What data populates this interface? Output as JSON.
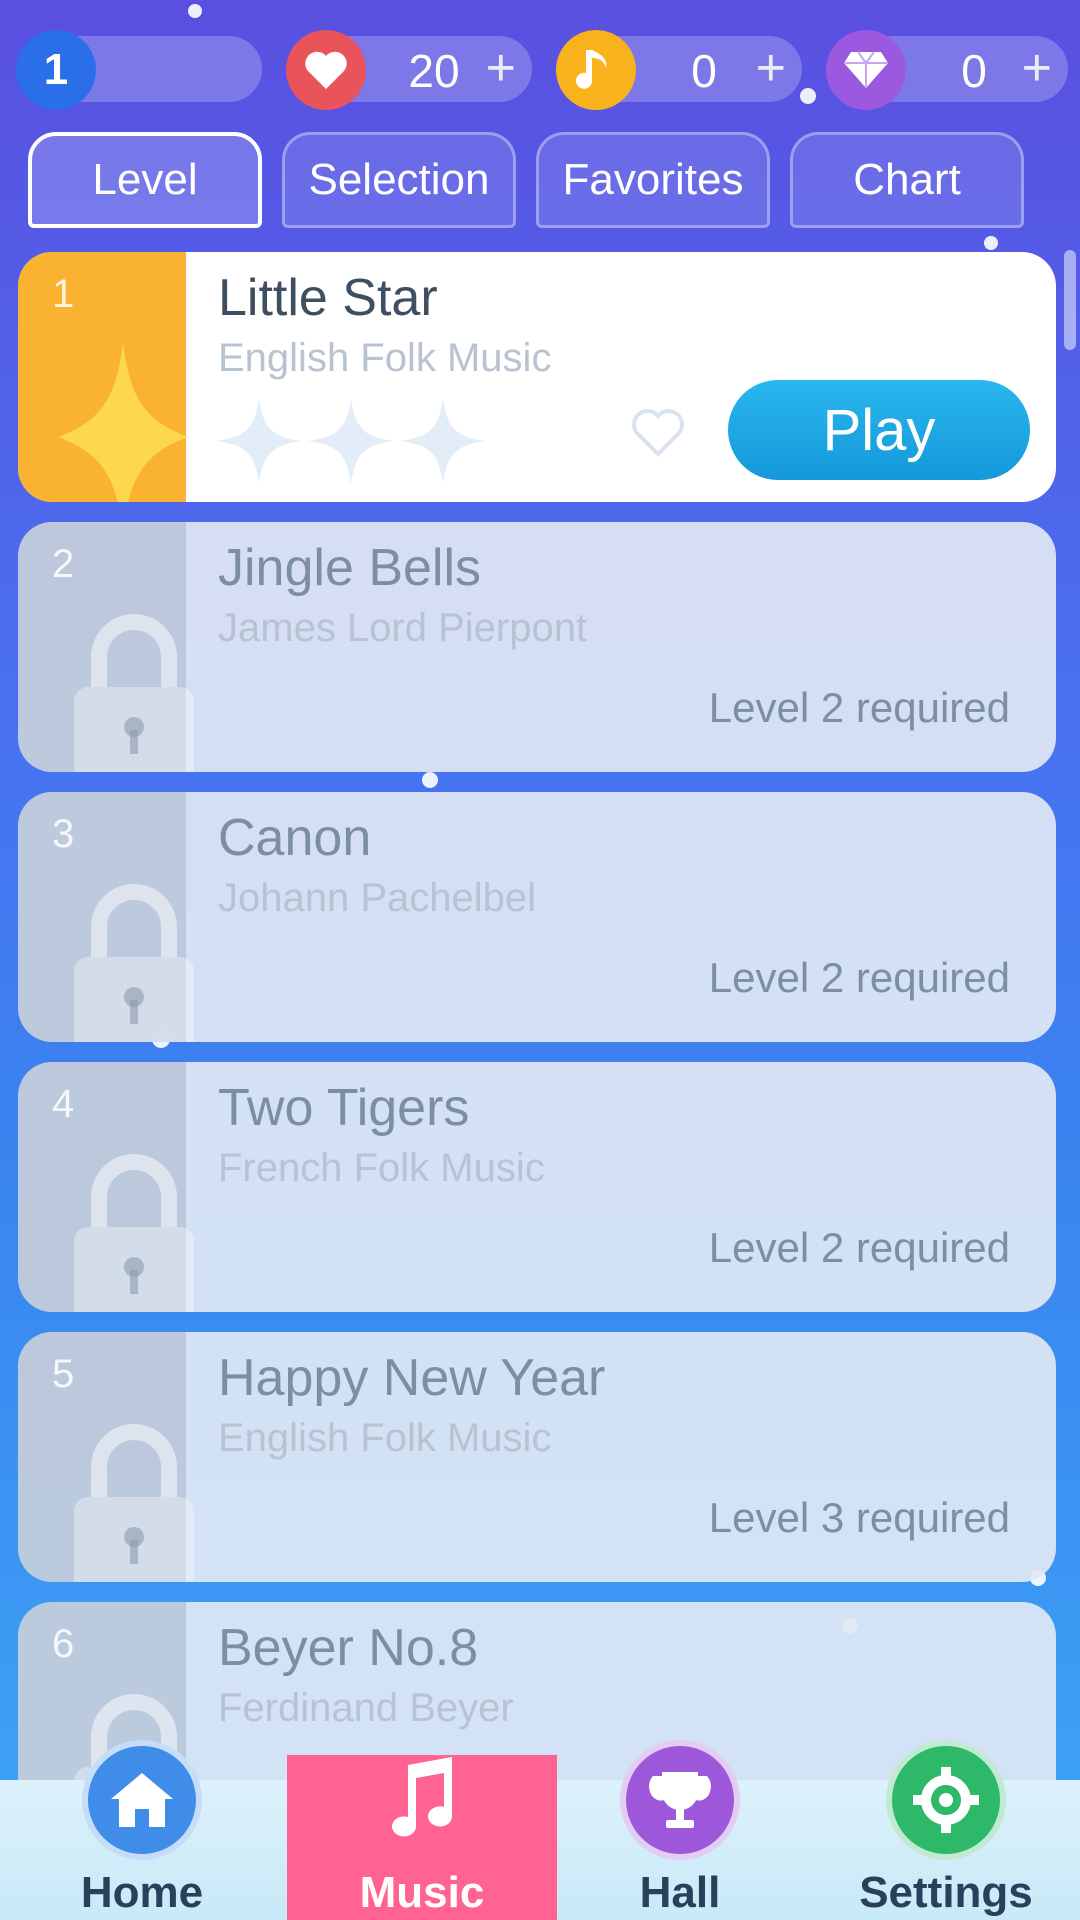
{
  "resources": {
    "level": "1",
    "lives": "20",
    "notes": "0",
    "diamonds": "0",
    "plus": "+"
  },
  "tabs": [
    {
      "label": "Level"
    },
    {
      "label": "Selection"
    },
    {
      "label": "Favorites"
    },
    {
      "label": "Chart"
    }
  ],
  "songs": [
    {
      "num": "1",
      "title": "Little Star",
      "artist": "English Folk Music",
      "play_label": "Play"
    },
    {
      "num": "2",
      "title": "Jingle Bells",
      "artist": "James Lord Pierpont",
      "requirement": "Level 2 required"
    },
    {
      "num": "3",
      "title": "Canon",
      "artist": "Johann Pachelbel",
      "requirement": "Level 2 required"
    },
    {
      "num": "4",
      "title": "Two Tigers",
      "artist": "French Folk Music",
      "requirement": "Level 2 required"
    },
    {
      "num": "5",
      "title": "Happy New Year",
      "artist": "English Folk Music",
      "requirement": "Level 3 required"
    },
    {
      "num": "6",
      "title": "Beyer No.8",
      "artist": "Ferdinand Beyer"
    }
  ],
  "nav": [
    {
      "label": "Home"
    },
    {
      "label": "Music"
    },
    {
      "label": "Hall"
    },
    {
      "label": "Settings"
    }
  ],
  "colors": {
    "lives": "#e9545a",
    "notes": "#f7b21c",
    "diamonds": "#9b59e0",
    "level": "#2b6fe8",
    "active_nav": "#ff6392",
    "play": "#1ea6e4"
  }
}
